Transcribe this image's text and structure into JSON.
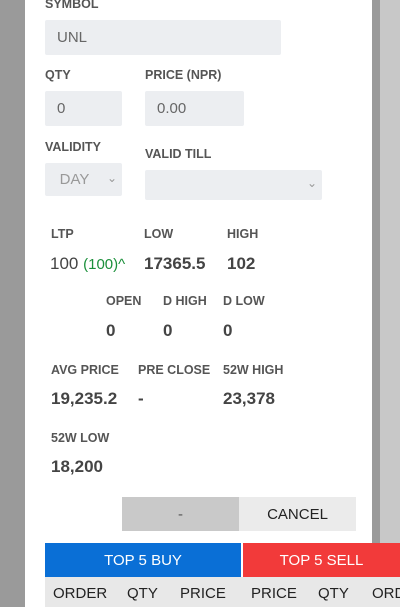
{
  "form": {
    "symbol_label": "SYMBOL",
    "symbol_value": "UNL",
    "qty_label": "QTY",
    "qty_value": "0",
    "price_label": "PRICE (NPR)",
    "price_value": "0.00",
    "validity_label": "VALIDITY",
    "validity_value": "DAY",
    "valid_till_label": "VALID TILL",
    "valid_till_value": ""
  },
  "stats": {
    "ltp_label": "LTP",
    "ltp_value": "100",
    "ltp_change": "(100)^",
    "low_label": "LOW",
    "low_value": "17365.5",
    "high_label": "HIGH",
    "high_value": "102",
    "open_label": "OPEN",
    "open_value": "0",
    "dhigh_label": "D HIGH",
    "dhigh_value": "0",
    "dlow_label": "D LOW",
    "dlow_value": "0",
    "avg_label": "AVG PRICE",
    "avg_value": "19,235.2",
    "preclose_label": "PRE CLOSE",
    "preclose_value": "-",
    "w52high_label": "52W HIGH",
    "w52high_value": "23,378",
    "w52low_label": "52W LOW",
    "w52low_value": "18,200"
  },
  "actions": {
    "submit_label": "-",
    "cancel_label": "CANCEL"
  },
  "tabs": {
    "buy_label": "TOP 5 BUY",
    "sell_label": "TOP 5 SELL",
    "buy_color": "#0a6fd6",
    "sell_color": "#f23a3a"
  },
  "table_headers": [
    "ORDER",
    "QTY",
    "PRICE",
    "PRICE",
    "QTY",
    "ORD"
  ]
}
